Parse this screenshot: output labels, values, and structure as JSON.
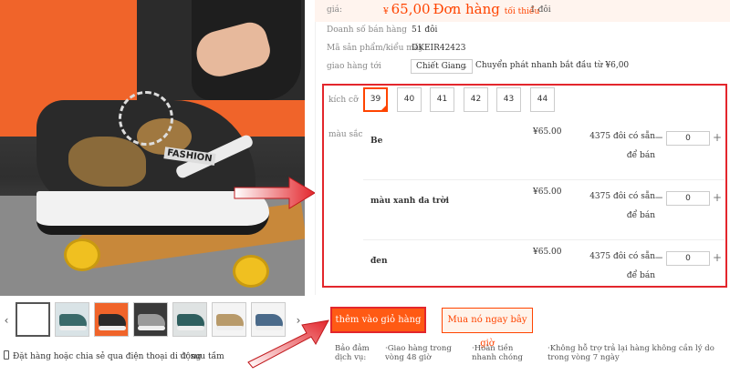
{
  "price": {
    "label": "giá:",
    "currency": "¥",
    "amount": "65,00",
    "unit": "Đơn hàng",
    "min_label": "tối thiểu",
    "min_qty": "1 đôi"
  },
  "sales": {
    "label": "Doanh số bán hàng",
    "value": "51",
    "unit": "đôi"
  },
  "model": {
    "label": "Mã sản phẩm/kiểu máy",
    "value": "DKEIR42423"
  },
  "shipping": {
    "label": "giao hàng tới",
    "region": "Chiết Giang",
    "note": "Chuyển phát nhanh bắt đầu từ ¥6,00"
  },
  "size": {
    "label": "kích cỡ",
    "options": [
      "39",
      "40",
      "41",
      "42",
      "43",
      "44"
    ],
    "selected": "39"
  },
  "color": {
    "label": "màu sắc",
    "rows": [
      {
        "name": "Be",
        "price": "¥65.00",
        "stock": "4375 đôi có sẵn để bán",
        "qty": "0"
      },
      {
        "name": "màu xanh da trời",
        "price": "¥65.00",
        "stock": "4375 đôi có sẵn để bán",
        "qty": "0"
      },
      {
        "name": "đen",
        "price": "¥65.00",
        "stock": "4375 đôi có sẵn để bán",
        "qty": "0"
      }
    ]
  },
  "actions": {
    "add_to_cart": "thêm vào giỏ hàng",
    "buy_now": "Mua nó ngay bây giờ"
  },
  "gallery": {
    "logo_text": "FASHION",
    "prev": "‹",
    "next": "›"
  },
  "share": {
    "label": "Đặt hàng hoặc chia sẻ qua điện thoại di động"
  },
  "favorite": {
    "label": "sưu tầm"
  },
  "guarantees": [
    "Bảo đảm dịch vụ:",
    "·Giao hàng trong vòng 48 giờ",
    "·Hoàn tiền nhanh chóng",
    "·Không hỗ trợ trả lại hàng không cần lý do trong vòng 7 ngày"
  ],
  "colors": {
    "accent": "#ff4400",
    "highlight": "#e3262c",
    "price_band": "#fff4ee"
  },
  "icons": [
    "phone-icon",
    "star-icon",
    "chevron-down-icon",
    "minus-icon",
    "plus-icon"
  ]
}
